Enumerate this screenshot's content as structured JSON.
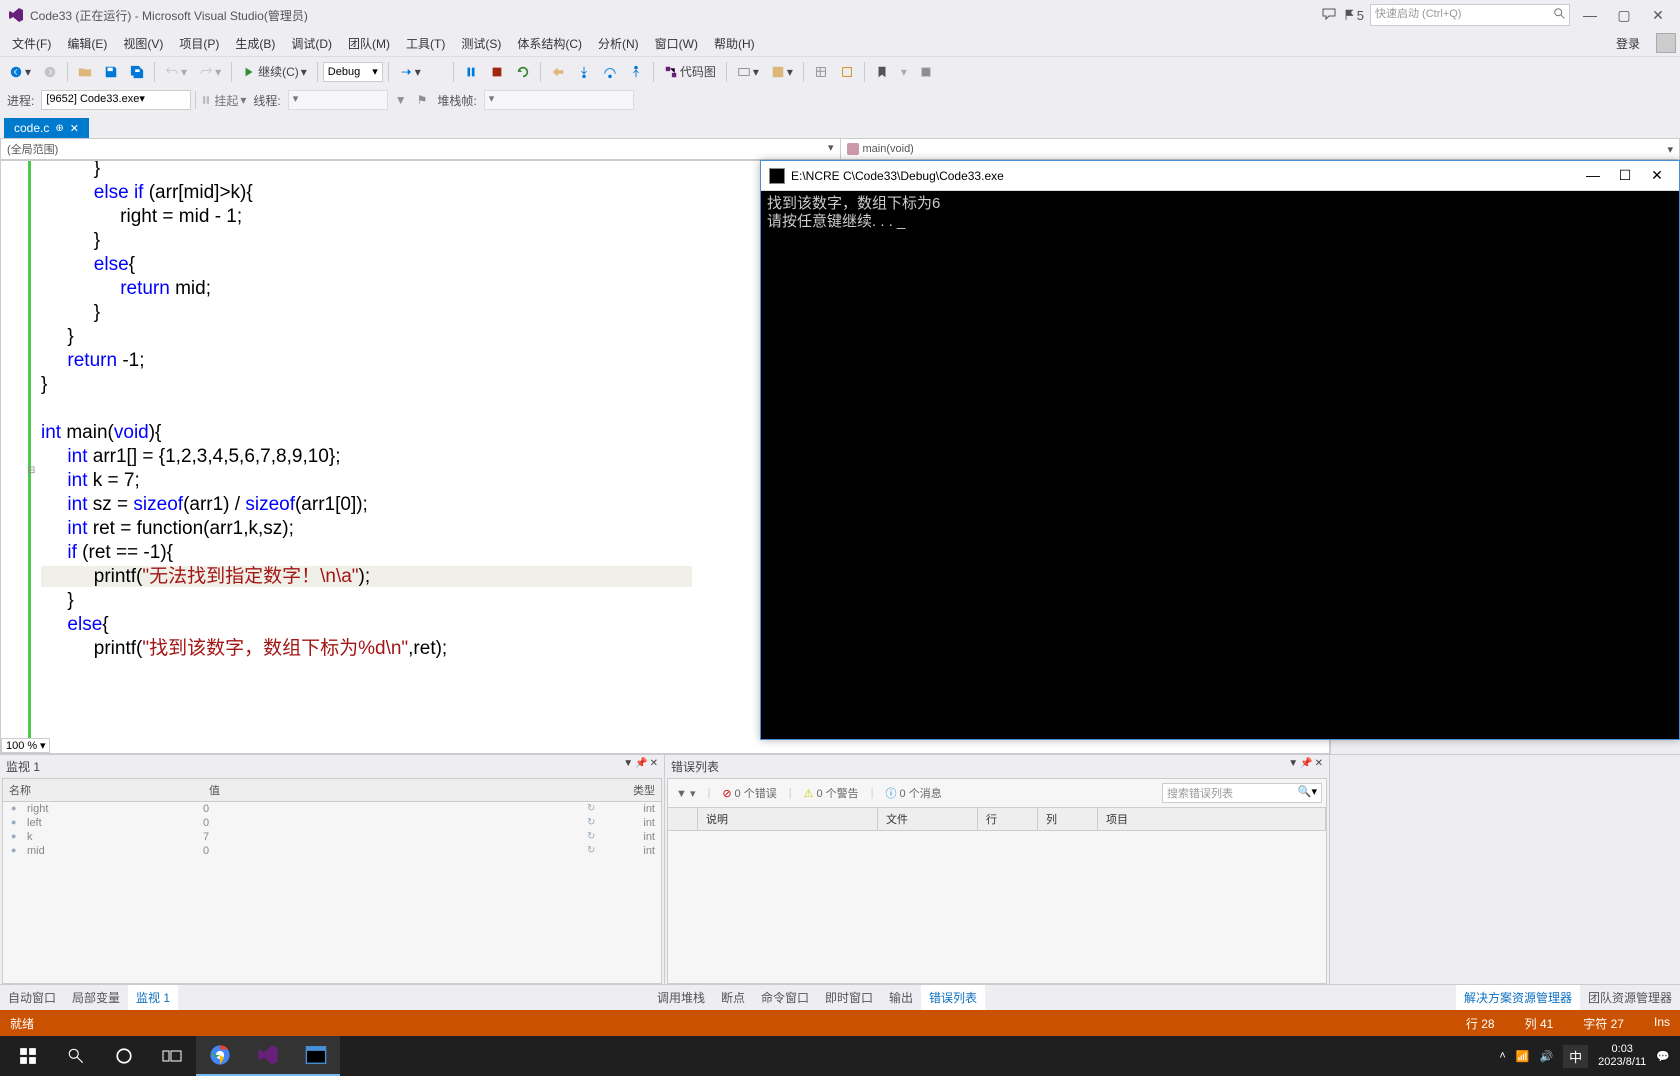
{
  "title": "Code33 (正在运行) - Microsoft Visual Studio(管理员)",
  "flag_count": "5",
  "quick_launch_placeholder": "快速启动 (Ctrl+Q)",
  "menu": [
    "文件(F)",
    "编辑(E)",
    "视图(V)",
    "项目(P)",
    "生成(B)",
    "调试(D)",
    "团队(M)",
    "工具(T)",
    "测试(S)",
    "体系结构(C)",
    "分析(N)",
    "窗口(W)",
    "帮助(H)"
  ],
  "login": "登录",
  "toolbar": {
    "continue": "继续(C)",
    "config": "Debug",
    "codemap": "代码图"
  },
  "toolbar2": {
    "process_lbl": "进程:",
    "process": "[9652] Code33.exe",
    "suspend": "挂起",
    "thread": "线程:",
    "stackframe": "堆栈帧:"
  },
  "tab": {
    "name": "code.c"
  },
  "nav": {
    "left": "(全局范围)",
    "right": "main(void)"
  },
  "zoom": "100 %",
  "solexp": {
    "title": "解决方案资源管理器"
  },
  "console": {
    "title": "E:\\NCRE C\\Code33\\Debug\\Code33.exe",
    "line1": "找到该数字，数组下标为6",
    "line2": "请按任意键继续. . . _"
  },
  "watch": {
    "title": "监视 1",
    "cols": {
      "name": "名称",
      "value": "值",
      "type": "类型"
    },
    "rows": [
      {
        "n": "right",
        "v": "0",
        "t": "int"
      },
      {
        "n": "left",
        "v": "0",
        "t": "int"
      },
      {
        "n": "k",
        "v": "7",
        "t": "int"
      },
      {
        "n": "mid",
        "v": "0",
        "t": "int"
      }
    ]
  },
  "errlist": {
    "title": "错误列表",
    "errors": "0 个错误",
    "warnings": "0 个警告",
    "messages": "0 个消息",
    "search_ph": "搜索错误列表",
    "cols": {
      "desc": "说明",
      "file": "文件",
      "line": "行",
      "col": "列",
      "proj": "项目"
    }
  },
  "bottom_tabs_left": [
    "自动窗口",
    "局部变量",
    "监视 1"
  ],
  "bottom_tabs_mid": [
    "调用堆栈",
    "断点",
    "命令窗口",
    "即时窗口",
    "输出",
    "错误列表"
  ],
  "bottom_tabs_right": [
    "解决方案资源管理器",
    "团队资源管理器"
  ],
  "status": {
    "ready": "就绪",
    "line": "行 28",
    "col": "列 41",
    "char": "字符 27",
    "ins": "Ins"
  },
  "tray": {
    "time": "0:03",
    "date": "2023/8/11",
    "ime": "中"
  }
}
